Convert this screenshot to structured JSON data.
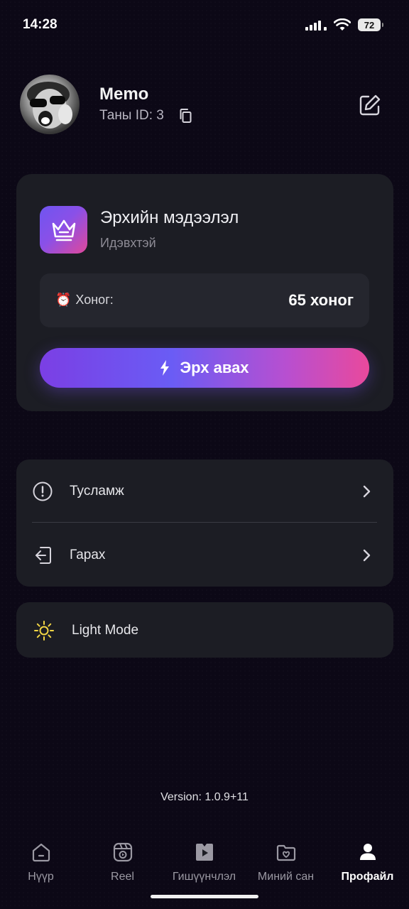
{
  "status_bar": {
    "time": "14:28",
    "battery": "72",
    "icons": [
      "signal-icon",
      "wifi-icon",
      "battery-icon"
    ]
  },
  "profile": {
    "name": "Memo",
    "id_label": "Таны ID: 3",
    "icons": [
      "avatar",
      "copy-icon",
      "edit-icon"
    ]
  },
  "subscription": {
    "title": "Эрхийн мэдээлэл",
    "status": "Идэвхтэй",
    "days_label": "Хоног:",
    "days_value": "65 хоног",
    "button_label": "Эрх авах",
    "icons": [
      "crown-icon",
      "alarm-clock-icon",
      "lightning-icon"
    ],
    "gradient": [
      "#7b3fe4",
      "#6a5cf5",
      "#e9499c"
    ]
  },
  "menu": {
    "items": [
      {
        "label": "Тусламж",
        "icon": "info-circle-icon"
      },
      {
        "label": "Гарах",
        "icon": "logout-icon"
      }
    ]
  },
  "mode": {
    "label": "Light Mode",
    "icon": "sun-icon",
    "icon_color": "#f2d544"
  },
  "version": "Version: 1.0.9+11",
  "nav": {
    "items": [
      {
        "label": "Нүүр",
        "icon": "home-icon"
      },
      {
        "label": "Reel",
        "icon": "reel-icon"
      },
      {
        "label": "Гишүүнчлэл",
        "icon": "membership-icon"
      },
      {
        "label": "Миний сан",
        "icon": "library-icon"
      },
      {
        "label": "Профайл",
        "icon": "profile-icon",
        "active": true
      }
    ]
  },
  "colors": {
    "background": "#0c0816",
    "card": "#1c1d24",
    "accent_start": "#7b3fe4",
    "accent_end": "#e9499c"
  }
}
